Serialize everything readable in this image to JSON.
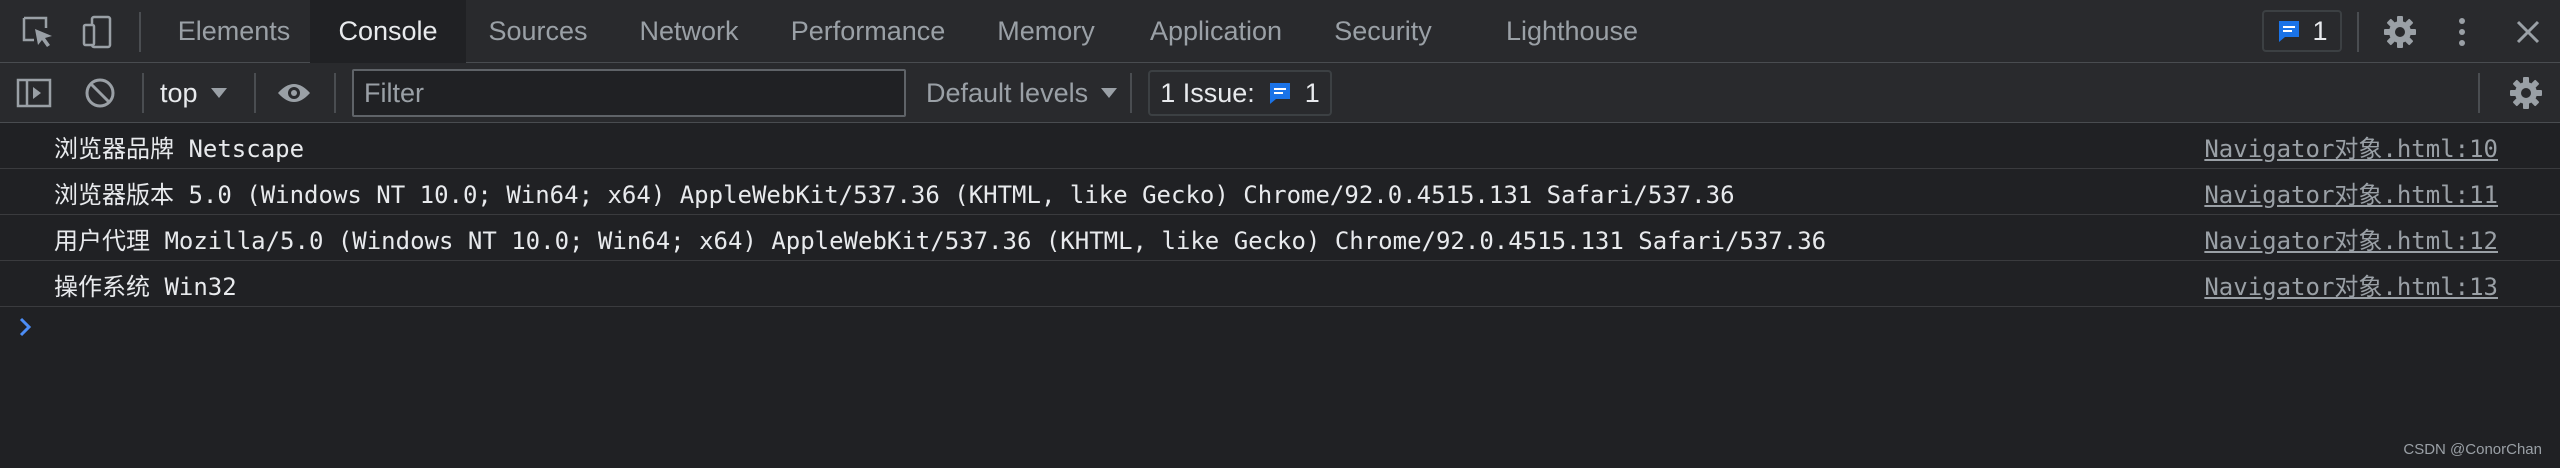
{
  "tabs": [
    {
      "label": "Elements"
    },
    {
      "label": "Console"
    },
    {
      "label": "Sources"
    },
    {
      "label": "Network"
    },
    {
      "label": "Performance"
    },
    {
      "label": "Memory"
    },
    {
      "label": "Application"
    },
    {
      "label": "Security"
    },
    {
      "label": "Lighthouse"
    }
  ],
  "active_tab": "Console",
  "header_issues": {
    "count": "1"
  },
  "toolbar": {
    "context": "top",
    "filter_placeholder": "Filter",
    "filter_value": "",
    "levels": "Default levels",
    "issues_label": "1 Issue:",
    "issues_count": "1"
  },
  "messages": [
    {
      "text": "浏览器品牌 Netscape",
      "source": "Navigator对象.html:10"
    },
    {
      "text": "浏览器版本 5.0 (Windows NT 10.0; Win64; x64) AppleWebKit/537.36 (KHTML, like Gecko) Chrome/92.0.4515.131 Safari/537.36",
      "source": "Navigator对象.html:11"
    },
    {
      "text": "用户代理 Mozilla/5.0 (Windows NT 10.0; Win64; x64) AppleWebKit/537.36 (KHTML, like Gecko) Chrome/92.0.4515.131 Safari/537.36",
      "source": "Navigator对象.html:12"
    },
    {
      "text": "操作系统 Win32",
      "source": "Navigator对象.html:13"
    }
  ],
  "watermark": "CSDN @ConorChan",
  "colors": {
    "background": "#202124",
    "toolbar": "#292a2d",
    "accent_blue": "#1a73e8",
    "prompt_blue": "#4c8df6"
  },
  "icons": {
    "inspect": "inspect-element-icon",
    "device": "device-toolbar-icon",
    "settings": "gear-icon",
    "more": "kebab-menu-icon",
    "close": "close-icon",
    "sidebar": "sidebar-toggle-icon",
    "clear": "clear-console-icon",
    "eye": "eye-icon",
    "message": "message-icon"
  }
}
